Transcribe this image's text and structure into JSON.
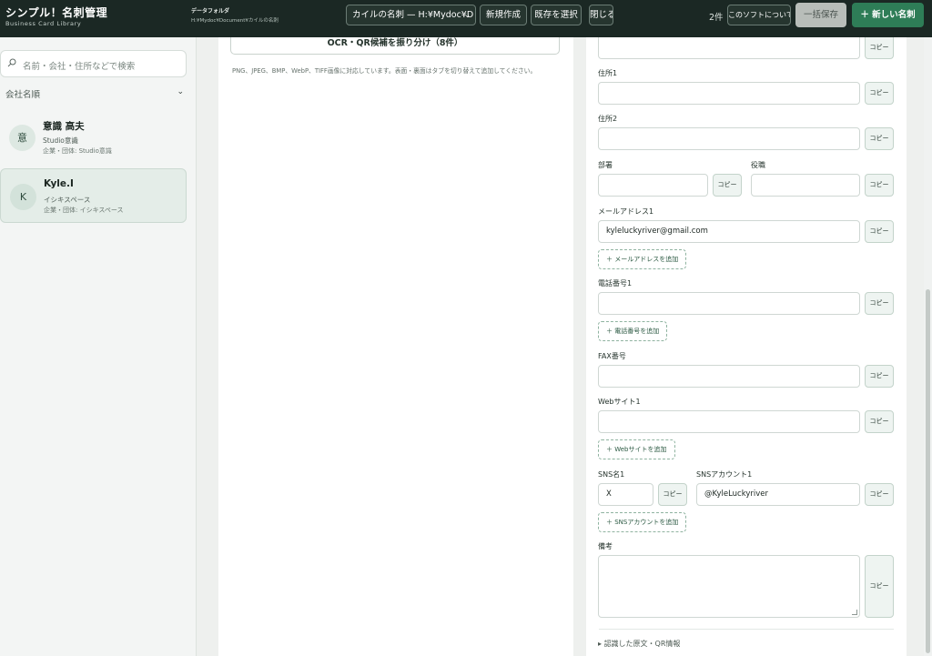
{
  "app": {
    "title": "シンプル！名刺管理",
    "subtitle": "Business Card Library"
  },
  "folder": {
    "label": "データフォルダ",
    "path": "H:¥Mydoc¥Document¥カイルの名刺"
  },
  "toolbar": {
    "library_select": "カイルの名刺 — H:¥Mydoc¥D",
    "new_label": "新規作成",
    "open_label": "既存を選択",
    "close_label": "閉じる",
    "count": "2件",
    "about_label": "このソフトについて",
    "save_all_label": "一括保存",
    "add_card_label": "＋ 新しい名刺"
  },
  "sidebar": {
    "search_placeholder": "名前・会社・住所などで検索",
    "sort_label": "会社名順",
    "cards": [
      {
        "avatar": "意",
        "name": "意識 高夫",
        "company": "Studio意識",
        "org": "企業・団体: Studio意識"
      },
      {
        "avatar": "K",
        "name": "Kyle.I",
        "company": "イシキスペース",
        "org": "企業・団体: イシキスペース"
      }
    ]
  },
  "middle": {
    "ocr_button": "OCR・QR候補を振り分け（8件）",
    "note": "PNG、JPEG、BMP、WebP、TIFF画像に対応しています。表面・裏面はタブを切り替えて追加してください。"
  },
  "form": {
    "copy_label": "コピー",
    "address1_label": "住所1",
    "address1_value": "",
    "address2_label": "住所2",
    "address2_value": "",
    "department_label": "部署",
    "department_value": "",
    "position_label": "役職",
    "position_value": "",
    "email_label": "メールアドレス1",
    "email_value": "kyleluckyriver@gmail.com",
    "add_email": "＋ メールアドレスを追加",
    "phone_label": "電話番号1",
    "phone_value": "",
    "add_phone": "＋ 電話番号を追加",
    "fax_label": "FAX番号",
    "fax_value": "",
    "website_label": "Webサイト1",
    "website_value": "",
    "add_website": "＋ Webサイトを追加",
    "sns_name_label": "SNS名1",
    "sns_name_value": "X",
    "sns_account_label": "SNSアカウント1",
    "sns_account_value": "@KyleLuckyriver",
    "add_sns": "＋ SNSアカウントを追加",
    "notes_label": "備考",
    "details_toggle": "認識した原文・QR情報"
  }
}
